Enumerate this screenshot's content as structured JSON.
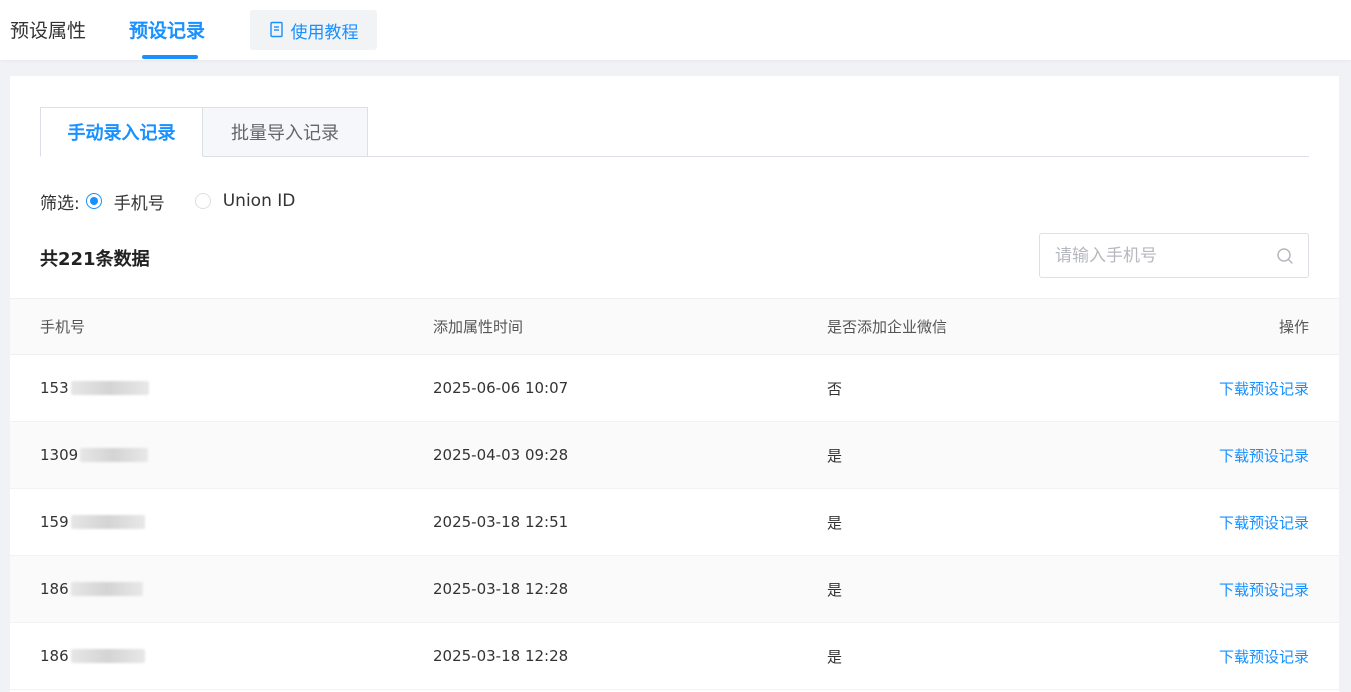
{
  "nav": {
    "tabs": [
      {
        "label": "预设属性",
        "active": false
      },
      {
        "label": "预设记录",
        "active": true
      }
    ],
    "tutorial_label": "使用教程",
    "accent": "#1890ff"
  },
  "subtabs": [
    {
      "label": "手动录入记录",
      "active": true
    },
    {
      "label": "批量导入记录",
      "active": false
    }
  ],
  "filter": {
    "label": "筛选:",
    "options": [
      {
        "label": "手机号",
        "checked": true
      },
      {
        "label": "Union ID",
        "checked": false
      }
    ]
  },
  "count_text": "共221条数据",
  "search": {
    "placeholder": "请输入手机号",
    "value": ""
  },
  "table": {
    "headers": [
      "手机号",
      "添加属性时间",
      "是否添加企业微信",
      "操作"
    ],
    "rows": [
      {
        "phone_prefix": "153",
        "time": "2025-06-06 10:07",
        "wechat": "否",
        "action": "下载预设记录"
      },
      {
        "phone_prefix": "1309",
        "time": "2025-04-03 09:28",
        "wechat": "是",
        "action": "下载预设记录"
      },
      {
        "phone_prefix": "159",
        "time": "2025-03-18 12:51",
        "wechat": "是",
        "action": "下载预设记录"
      },
      {
        "phone_prefix": "186",
        "time": "2025-03-18 12:28",
        "wechat": "是",
        "action": "下载预设记录"
      },
      {
        "phone_prefix": "186",
        "time": "2025-03-18 12:28",
        "wechat": "是",
        "action": "下载预设记录"
      }
    ]
  }
}
